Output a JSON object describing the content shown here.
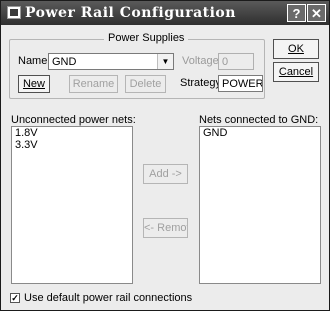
{
  "window": {
    "title": "Power Rail Configuration",
    "help_glyph": "?",
    "close_glyph": "✕"
  },
  "power_supplies": {
    "group_label": "Power Supplies",
    "name_label": "Name",
    "name_value": "GND",
    "voltage_label": "Voltage",
    "voltage_value": "0",
    "strategy_label": "Strategy",
    "strategy_value": "POWER",
    "new_label": "New",
    "rename_label": "Rename",
    "delete_label": "Delete"
  },
  "dialog_buttons": {
    "ok_label": "OK",
    "cancel_label": "Cancel"
  },
  "unconnected": {
    "label": "Unconnected power nets:",
    "items": [
      "1.8V",
      "3.3V"
    ]
  },
  "connected": {
    "label": "Nets connected to GND:",
    "items": [
      "GND"
    ]
  },
  "transfer": {
    "add_label": "Add ->",
    "remove_label": "<- Remove"
  },
  "footer": {
    "checkbox_label": "Use default power rail connections",
    "checked": true
  }
}
